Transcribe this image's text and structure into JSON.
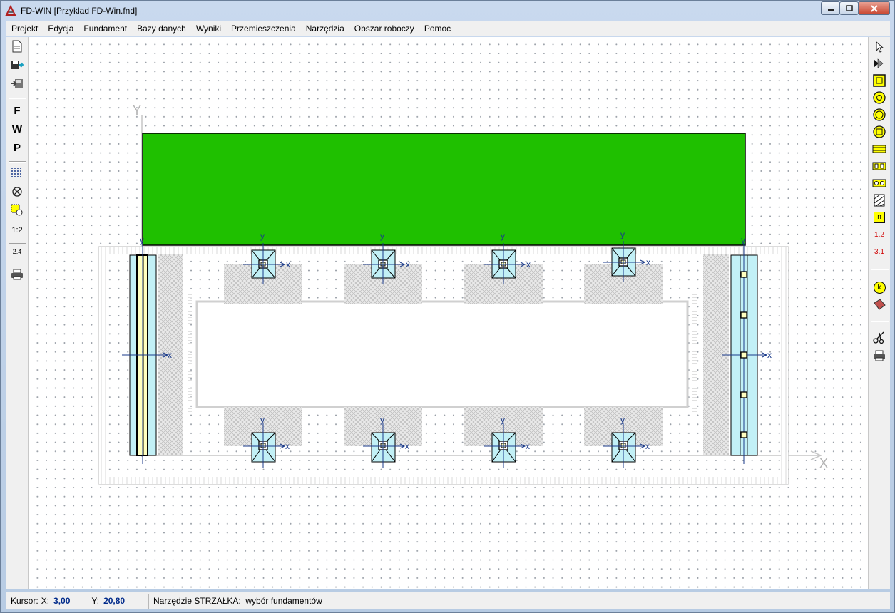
{
  "window": {
    "title": "FD-WIN [Przyklad FD-Win.fnd]"
  },
  "menu": [
    {
      "label": "Projekt"
    },
    {
      "label": "Edycja"
    },
    {
      "label": "Fundament"
    },
    {
      "label": "Bazy danych"
    },
    {
      "label": "Wyniki"
    },
    {
      "label": "Przemieszczenia"
    },
    {
      "label": "Narzędzia"
    },
    {
      "label": "Obszar roboczy"
    },
    {
      "label": "Pomoc"
    }
  ],
  "left_toolbar": {
    "f_label": "F",
    "w_label": "W",
    "p_label": "P",
    "scale_label": "1:2",
    "dim_label": "2.4"
  },
  "right_toolbar": {
    "n_label": "n",
    "dim1_label": "1.2",
    "dim2_label": "3.1",
    "k_label": "k"
  },
  "drawing": {
    "axis_y_label": "Y",
    "axis_x_label": "X",
    "local_x_label": "x",
    "local_y_label": "y",
    "colors": {
      "beam": "#1fc000",
      "footing": "#c2f0f6",
      "strip_core": "#ffffc0"
    }
  },
  "status": {
    "cursor_label": "Kursor:",
    "x_label": "X:",
    "x_value": "3,00",
    "y_label": "Y:",
    "y_value": "20,80",
    "tool_text": "Narzędzie STRZAŁKA:  wybór fundamentów"
  }
}
